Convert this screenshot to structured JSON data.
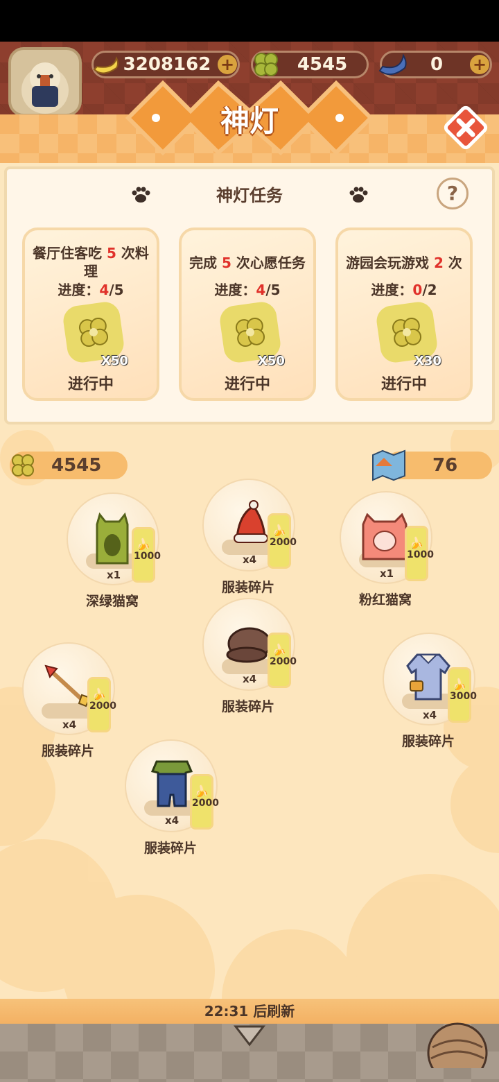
{
  "header": {
    "bananas": "3208162",
    "clovers": "4545",
    "blue_bananas": "0",
    "title": "神灯"
  },
  "tasks_panel": {
    "title": "神灯任务",
    "help_label": "?",
    "cards": [
      {
        "desc_pre": "餐厅住客吃 ",
        "desc_num": "5",
        "desc_post": " 次料理",
        "progress_label": "进度：",
        "progress_cur": "4",
        "progress_total": "/5",
        "reward_qty": "X50",
        "status": "进行中"
      },
      {
        "desc_pre": "完成 ",
        "desc_num": "5",
        "desc_post": " 次心愿任务",
        "progress_label": "进度：",
        "progress_cur": "4",
        "progress_total": "/5",
        "reward_qty": "X50",
        "status": "进行中"
      },
      {
        "desc_pre": "游园会玩游戏 ",
        "desc_num": "2",
        "desc_post": " 次",
        "progress_label": "进度：",
        "progress_cur": "0",
        "progress_total": "/2",
        "reward_qty": "X30",
        "status": "进行中"
      }
    ]
  },
  "shop": {
    "clover_count": "4545",
    "ticket_count": "76",
    "items": [
      {
        "name": "深绿猫窝",
        "qty": "x1",
        "price": "1000",
        "icon": "green-cat-bed-icon"
      },
      {
        "name": "服装碎片",
        "qty": "x4",
        "price": "2000",
        "icon": "santa-hat-icon"
      },
      {
        "name": "粉红猫窝",
        "qty": "x1",
        "price": "1000",
        "icon": "pink-cat-bed-icon"
      },
      {
        "name": "服装碎片",
        "qty": "x4",
        "price": "2000",
        "icon": "brown-cap-icon"
      },
      {
        "name": "服装碎片",
        "qty": "x4",
        "price": "2000",
        "icon": "arrow-icon"
      },
      {
        "name": "服装碎片",
        "qty": "x4",
        "price": "3000",
        "icon": "jacket-icon"
      },
      {
        "name": "服装碎片",
        "qty": "x4",
        "price": "2000",
        "icon": "overalls-icon"
      }
    ],
    "refresh_text": "22:31 后刷新"
  },
  "colors": {
    "accent_orange": "#F6B467",
    "clover_green": "#A8B83A",
    "tag_yellow": "#EFE26B",
    "progress_red": "#E0312A"
  }
}
